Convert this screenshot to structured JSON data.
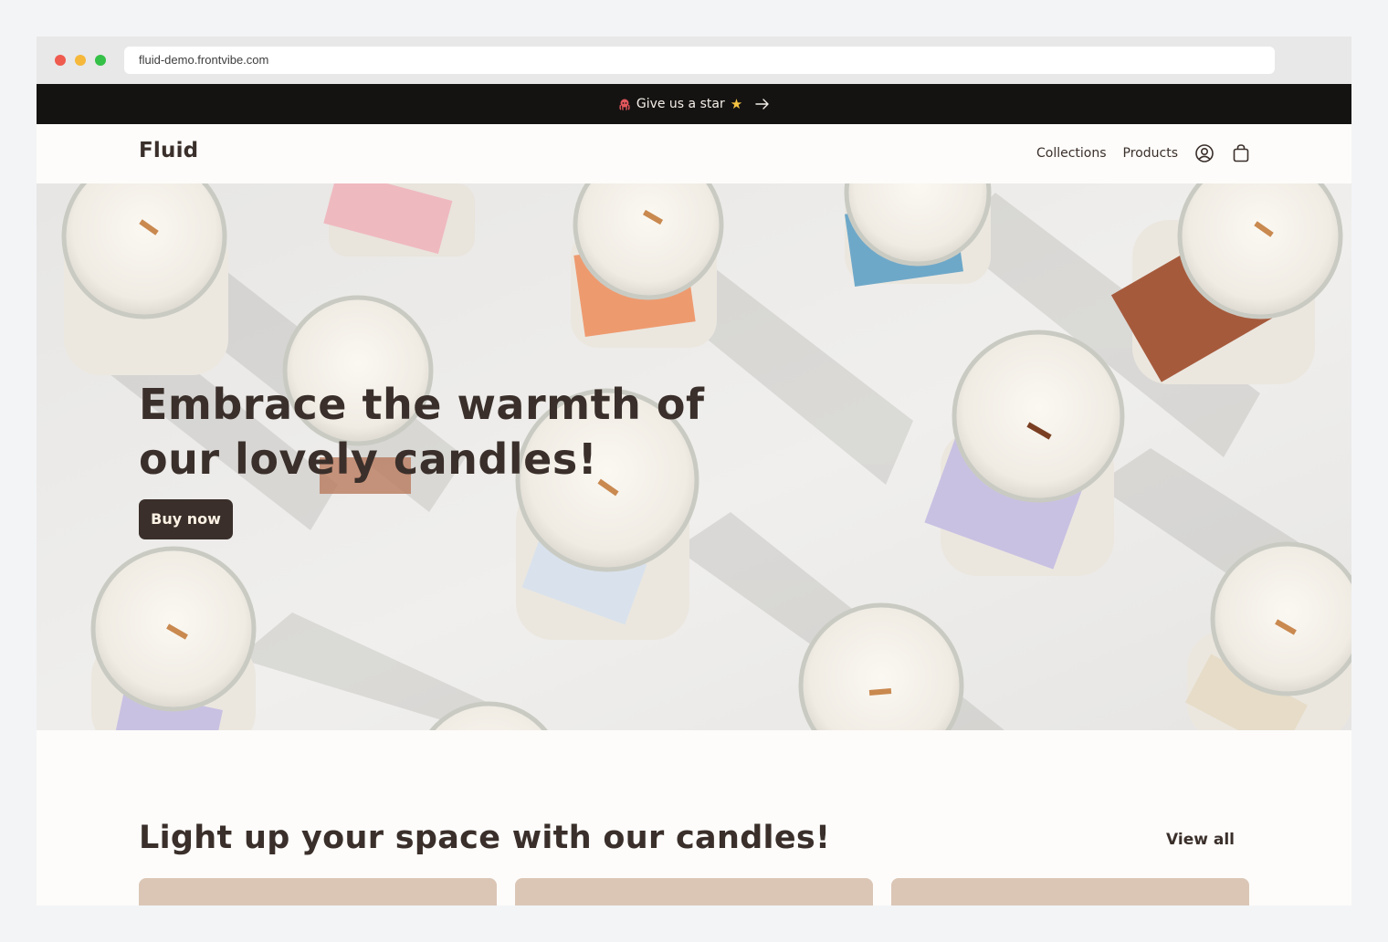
{
  "browser": {
    "url": "fluid-demo.frontvibe.com"
  },
  "announcement": {
    "text": "Give us a star",
    "icon_left": "octopus-icon",
    "icon_star": "star-icon",
    "icon_right": "arrow-right-icon"
  },
  "header": {
    "logo": "Fluid",
    "nav": {
      "collections": "Collections",
      "products": "Products"
    },
    "icons": [
      "account-icon",
      "bag-icon"
    ]
  },
  "hero": {
    "title": "Embrace the warmth of our lovely candles!",
    "button": "Buy now",
    "image": "candles-photo"
  },
  "featured": {
    "title": "Light up your space with our candles!",
    "view_all": "View all",
    "cards": [
      {},
      {},
      {}
    ]
  },
  "colors": {
    "brand_dark": "#3a2f2a",
    "announcement_bg": "#151312",
    "page_bg": "#fdfcfa",
    "card_bg": "#dbc6b6"
  }
}
